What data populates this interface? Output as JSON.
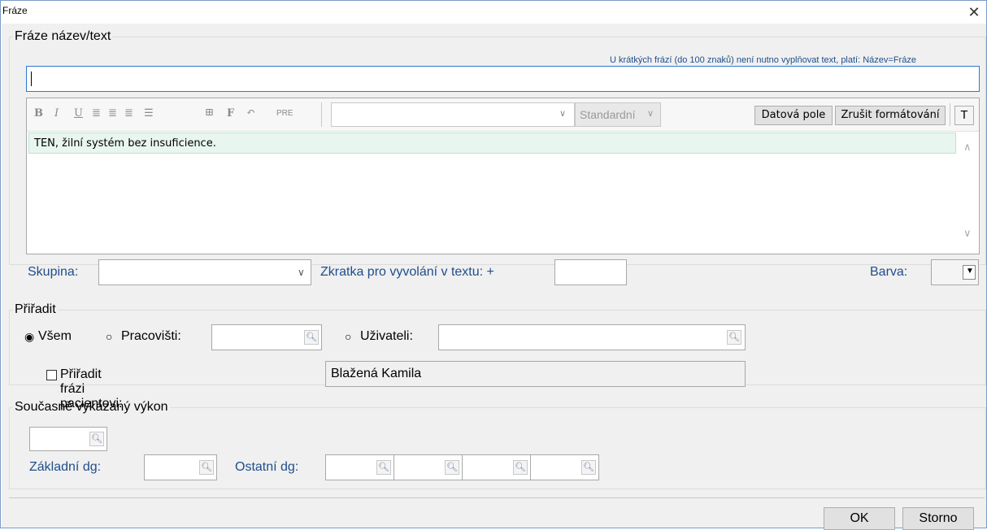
{
  "window": {
    "title": "Fráze",
    "close_glyph": "✕"
  },
  "phrase": {
    "legend": "Fráze název/text",
    "hint": "U krátkých frází (do 100 znaků) není nutno vyplňovat text, platí:  Název=Fráze",
    "name_value": "",
    "toolbar": {
      "bold": "B",
      "italic": "I",
      "underline": "U",
      "pre": "PRE",
      "style_select": "Standardní",
      "data_fields_button": "Datová pole",
      "clear_format_button": "Zrušit formátování",
      "t_button": "T"
    },
    "editor_text": "TEN, žilní systém bez insuficience."
  },
  "group_row": {
    "group_label": "Skupina:",
    "group_value": "",
    "shortcut_label": "Zkratka pro vyvolání v textu:  +",
    "shortcut_value": "",
    "color_label": "Barva:"
  },
  "assign": {
    "legend": "Přiřadit",
    "all_label": "Všem",
    "workplace_label": "Pracovišti:",
    "user_label": "Uživateli:",
    "patient_label": "Přiřadit frázi pacientovi:",
    "patient_value": "Blažená  Kamila",
    "selected": "all"
  },
  "performance": {
    "legend": "Současně vykázaný výkon",
    "basic_dg_label": "Základní dg:",
    "other_dg_label": "Ostatní dg:"
  },
  "footer": {
    "ok": "OK",
    "cancel": "Storno"
  },
  "colors": {
    "accent": "#1f4e8c",
    "editor_highlight": "#e8f6ef",
    "focus_border": "#2b78d6"
  }
}
